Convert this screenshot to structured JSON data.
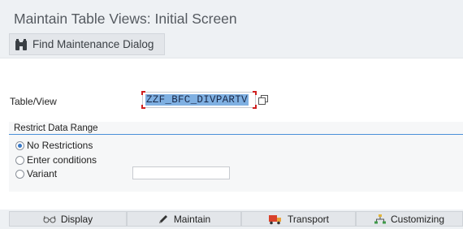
{
  "title": "Maintain Table Views: Initial Screen",
  "toolbar": {
    "find_label": "Find Maintenance Dialog"
  },
  "table_view": {
    "label": "Table/View",
    "value": "ZZF_BFC_DIVPARTV"
  },
  "restrict": {
    "header": "Restrict Data Range",
    "options": [
      "No Restrictions",
      "Enter conditions",
      "Variant"
    ],
    "selected": "No Restrictions",
    "variant_value": ""
  },
  "actions": {
    "display": "Display",
    "maintain": "Maintain",
    "transport": "Transport",
    "customizing": "Customizing"
  },
  "icons": {
    "find": "binoculars-icon",
    "value_help": "value-help-icon",
    "display": "glasses-icon",
    "maintain": "pencil-icon",
    "transport": "truck-icon",
    "customizing": "hierarchy-icon"
  },
  "colors": {
    "accent": "#4a90d9",
    "required_marker": "#d02020",
    "selection": "#7fb0e2"
  }
}
